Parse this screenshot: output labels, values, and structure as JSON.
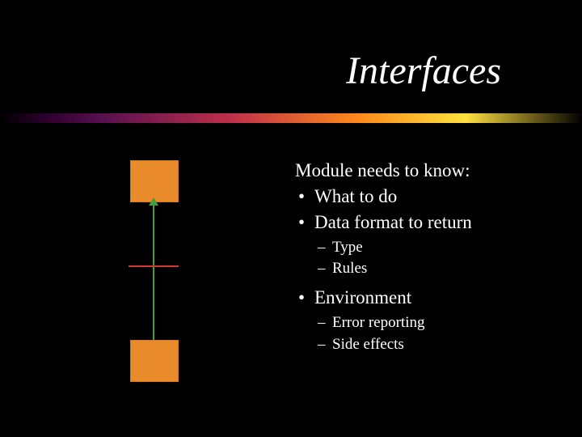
{
  "title": "Interfaces",
  "content": {
    "lead": "Module needs to know:",
    "bullets": [
      {
        "text": "What to do"
      },
      {
        "text": "Data format to return",
        "sub": [
          "Type",
          "Rules"
        ]
      },
      {
        "text": "Environment",
        "sub": [
          "Error reporting",
          "Side effects"
        ]
      }
    ]
  },
  "colors": {
    "background": "#000000",
    "text": "#ffffff",
    "box": "#e98b2a",
    "arrow": "#3fa040",
    "barrier": "#d0392b"
  }
}
